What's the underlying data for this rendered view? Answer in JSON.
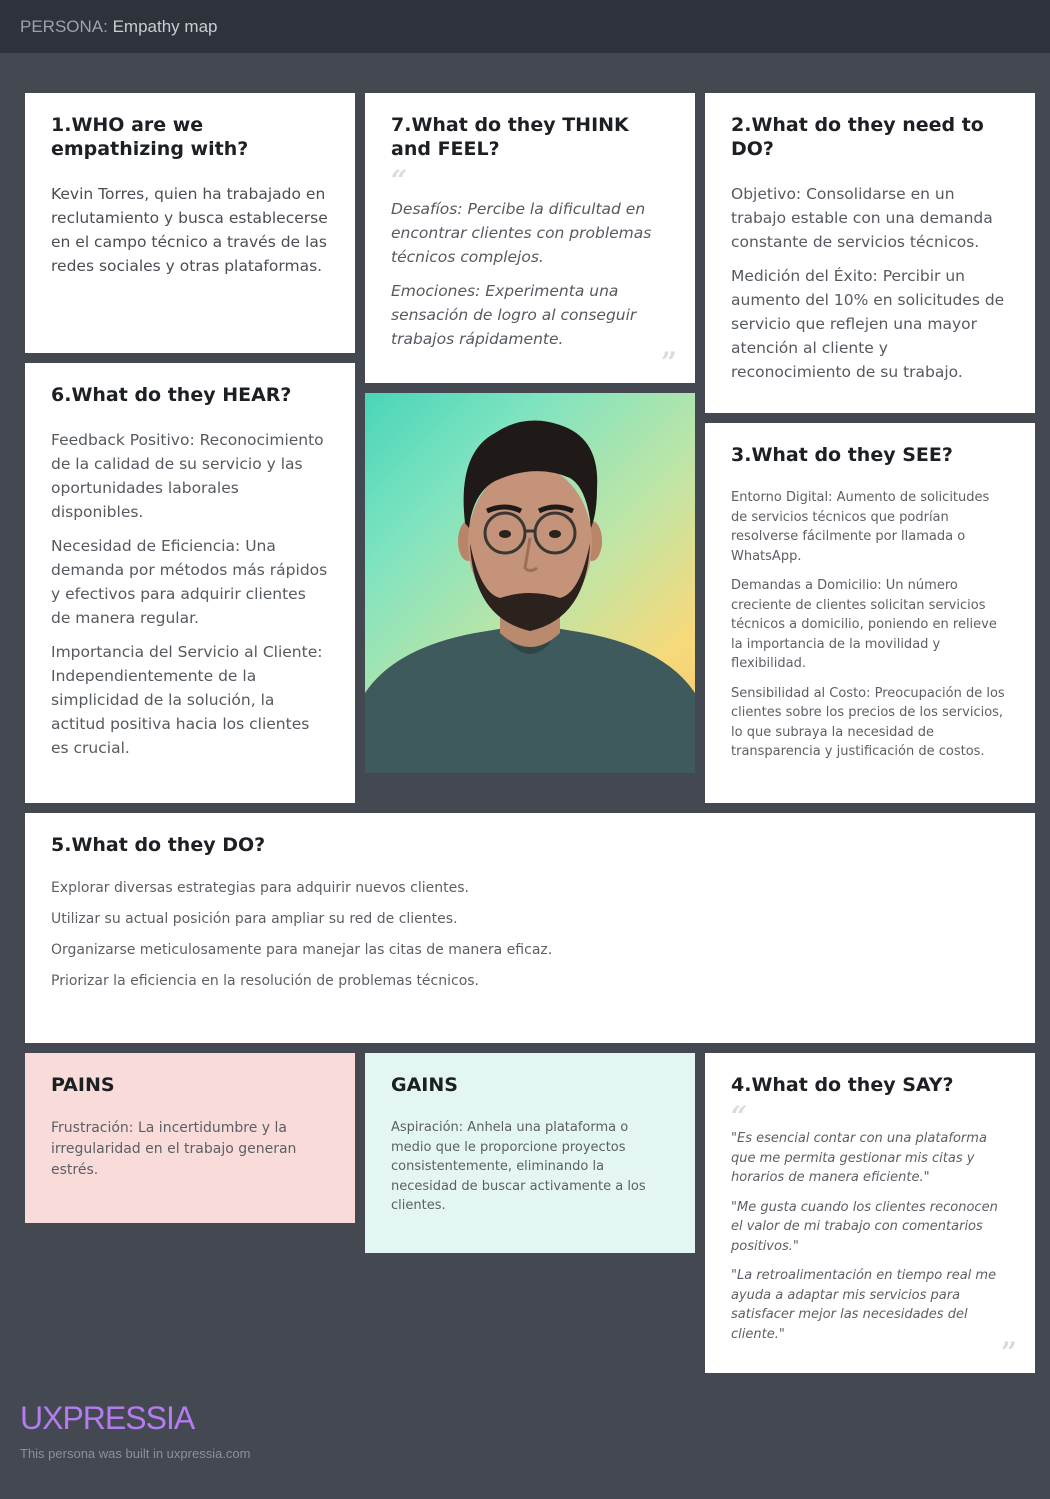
{
  "header": {
    "label": "PERSONA:",
    "title": "Empathy map"
  },
  "who": {
    "title": "1.WHO are we empathizing with?",
    "text": "Kevin Torres, quien ha trabajado en reclutamiento y busca establecerse en el campo técnico a través de las redes sociales y otras plataformas."
  },
  "think_feel": {
    "title": "7.What do they THINK and FEEL?",
    "items": [
      "Desafíos: Percibe la dificultad en encontrar clientes con problemas técnicos complejos.",
      "Emociones: Experimenta una sensación de logro al conseguir trabajos rápidamente."
    ]
  },
  "need_do": {
    "title": "2.What do they need to DO?",
    "items": [
      "Objetivo: Consolidarse en un trabajo estable con una demanda constante de servicios técnicos.",
      "Medición del Éxito: Percibir un aumento del 10% en solicitudes de servicio que reflejen una mayor atención al cliente y reconocimiento de su trabajo."
    ]
  },
  "hear": {
    "title": "6.What do they HEAR?",
    "items": [
      "Feedback Positivo: Reconocimiento de la calidad de su servicio y las oportunidades laborales disponibles.",
      "Necesidad de Eficiencia: Una demanda por métodos más rápidos y efectivos para adquirir clientes de manera regular.",
      "Importancia del Servicio al Cliente: Independientemente de la simplicidad de la solución, la actitud positiva hacia los clientes es crucial."
    ]
  },
  "see": {
    "title": "3.What do they SEE?",
    "items": [
      "Entorno Digital: Aumento de solicitudes de servicios técnicos que podrían resolverse fácilmente por llamada o WhatsApp.",
      "Demandas a Domicilio: Un número creciente de clientes solicitan servicios técnicos a domicilio, poniendo en relieve la importancia de la movilidad y flexibilidad.",
      "Sensibilidad al Costo: Preocupación de los clientes sobre los precios de los servicios, lo que subraya la necesidad de transparencia y justificación de costos."
    ]
  },
  "do": {
    "title": "5.What do they DO?",
    "items": [
      "Explorar diversas estrategias para adquirir nuevos clientes.",
      "Utilizar su actual posición para ampliar su red de clientes.",
      "Organizarse meticulosamente para manejar las citas de manera eficaz.",
      "Priorizar la eficiencia en la resolución de problemas técnicos."
    ]
  },
  "pains": {
    "title": "PAINS",
    "text": "Frustración: La incertidumbre y la irregularidad en el trabajo generan estrés."
  },
  "gains": {
    "title": "GAINS",
    "text": "Aspiración: Anhela una plataforma o medio que le proporcione proyectos consistentemente, eliminando la necesidad de buscar activamente a los clientes."
  },
  "say": {
    "title": "4.What do they SAY?",
    "items": [
      "\"Es esencial contar con una plataforma que me permita gestionar mis citas y horarios de manera eficiente.\"",
      "\"Me gusta cuando los clientes reconocen el valor de mi trabajo con comentarios positivos.\"",
      "\"La retroalimentación en tiempo real me ayuda a adaptar mis servicios para satisfacer mejor las necesidades del cliente.\""
    ]
  },
  "footer": {
    "logo": "UXPRESSIA",
    "note": "This persona was built in uxpressia.com"
  },
  "colors": {
    "background": "#434851",
    "pains_bg": "#f9dcd9",
    "gains_bg": "#e4f6f1",
    "logo": "#b57cf0"
  }
}
